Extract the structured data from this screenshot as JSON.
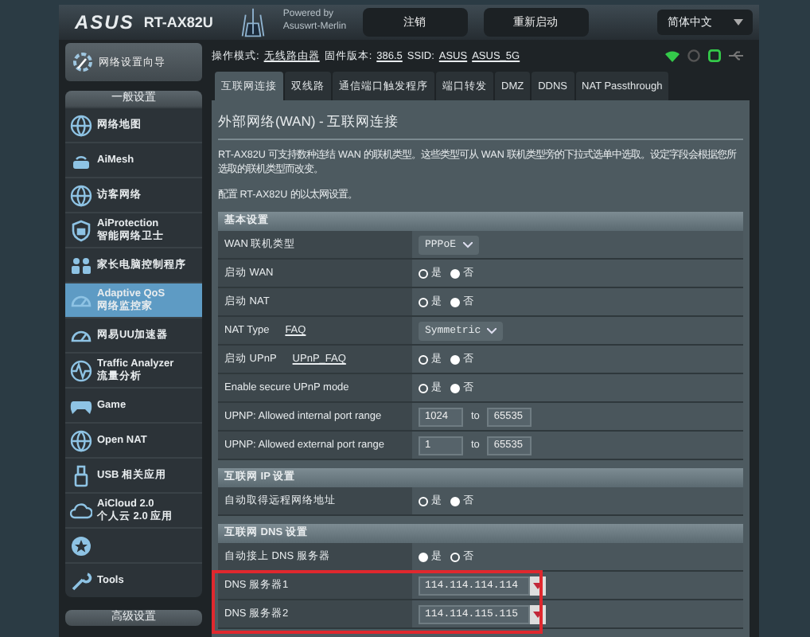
{
  "header": {
    "brand": "ASUS",
    "model": "RT-AX82U",
    "powered_by": "Powered by",
    "firmware_name": "Asuswrt-Merlin",
    "buttons": [
      "注销",
      "重新启动"
    ],
    "language": "简体中文"
  },
  "status_line": {
    "mode_label": "操作模式:",
    "mode": "无线路由器",
    "firmware_label": "固件版本:",
    "firmware": "386.5",
    "ssid_label": "SSID:",
    "ssids": [
      "ASUS",
      "ASUS_5G"
    ]
  },
  "sidebar": {
    "quick_setup": "网络设置向导",
    "general_title": "一般设置",
    "advanced_title": "高级设置",
    "items": [
      {
        "label": "网络地图",
        "selected": false
      },
      {
        "label": "AiMesh",
        "selected": false
      },
      {
        "label": "访客网络",
        "selected": false
      },
      {
        "label": "AiProtection",
        "sublabel": "智能网络卫士",
        "selected": false
      },
      {
        "label": "家长电脑控制程序",
        "selected": false
      },
      {
        "label": "Adaptive QoS",
        "sublabel": "网络监控家",
        "selected": true
      },
      {
        "label": "网易UU加速器",
        "selected": false
      },
      {
        "label": "Traffic Analyzer",
        "sublabel": "流量分析",
        "selected": false
      },
      {
        "label": "Game",
        "selected": false
      },
      {
        "label": "Open NAT",
        "selected": false
      },
      {
        "label": "USB 相关应用",
        "selected": false
      },
      {
        "label": "AiCloud 2.0",
        "sublabel": "个人云 2.0 应用",
        "selected": false
      },
      {
        "selected": false
      },
      {
        "label": "Tools",
        "selected": false
      }
    ]
  },
  "tabs": [
    {
      "label": "互联网连接",
      "selected": true
    },
    {
      "label": "双线路",
      "selected": false
    },
    {
      "label": "通信端口触发程序",
      "selected": false
    },
    {
      "label": "端口转发",
      "selected": false
    },
    {
      "label": "DMZ",
      "selected": false
    },
    {
      "label": "DDNS",
      "selected": false
    },
    {
      "label": "NAT Passthrough",
      "selected": false
    }
  ],
  "page": {
    "title": "外部网络(WAN) - 互联网连接",
    "description": "RT-AX82U 可支持数种连结 WAN 的联机类型。这些类型可从 WAN 联机类型旁的下拉式选单中选取。设定字段会根据您所选取的联机类型而改变。",
    "note": "配置 RT-AX82U 的以太网设置。"
  },
  "sections": [
    {
      "title": "基本设置",
      "rows": [
        {
          "label": "WAN 联机类型",
          "kind": "select",
          "value": "PPPoE"
        },
        {
          "label": "启动 WAN",
          "kind": "radio",
          "options": [
            {
              "label": "是",
              "selected": false
            },
            {
              "label": "否",
              "selected": true
            }
          ]
        },
        {
          "label": "启动 NAT",
          "kind": "radio",
          "options": [
            {
              "label": "是",
              "selected": false
            },
            {
              "label": "否",
              "selected": true
            }
          ]
        },
        {
          "label": "NAT Type",
          "link": "FAQ",
          "kind": "select",
          "value": "Symmetric"
        },
        {
          "label": "启动 UPnP",
          "link": "UPnP_FAQ",
          "kind": "radio",
          "options": [
            {
              "label": "是",
              "selected": false
            },
            {
              "label": "否",
              "selected": true
            }
          ]
        },
        {
          "label": "Enable secure UPnP mode",
          "kind": "radio",
          "options": [
            {
              "label": "是",
              "selected": false
            },
            {
              "label": "否",
              "selected": true
            }
          ]
        },
        {
          "label": "UPNP: Allowed internal port range",
          "kind": "range",
          "from": "1024",
          "separator": "to",
          "to": "65535"
        },
        {
          "label": "UPNP: Allowed external port range",
          "kind": "range",
          "from": "1",
          "separator": "to",
          "to": "65535"
        }
      ]
    },
    {
      "title": "互联网 IP 设置",
      "rows": [
        {
          "label": "自动取得远程网络地址",
          "kind": "radio",
          "options": [
            {
              "label": "是",
              "selected": false
            },
            {
              "label": "否",
              "selected": true
            }
          ]
        }
      ]
    },
    {
      "title": "互联网 DNS 设置",
      "rows": [
        {
          "label": "自动接上 DNS 服务器",
          "kind": "radio",
          "options": [
            {
              "label": "是",
              "selected": true
            },
            {
              "label": "否",
              "selected": false
            }
          ]
        },
        {
          "label": "DNS 服务器1",
          "kind": "combo",
          "value": "114.114.114.114",
          "highlighted": true
        },
        {
          "label": "DNS 服务器2",
          "kind": "combo",
          "value": "114.114.115.115",
          "highlighted": true
        }
      ]
    }
  ]
}
